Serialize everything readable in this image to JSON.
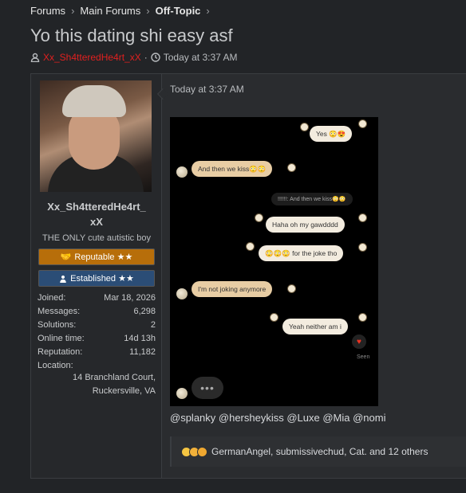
{
  "breadcrumb": [
    "Forums",
    "Main Forums",
    "Off-Topic"
  ],
  "thread": {
    "title": "Yo this dating shi easy asf",
    "author": "Xx_Sh4tteredHe4rt_xX",
    "separator": "·",
    "time": "Today at 3:37 AM"
  },
  "user": {
    "name_line1": "Xx_Sh4tteredHe4rt_",
    "name_line2": "xX",
    "title": "THE ONLY cute autistic boy",
    "badge_reputable": "Reputable ★★",
    "badge_established": "Established ★★",
    "stats": [
      {
        "label": "Joined:",
        "value": "Mar 18, 2026"
      },
      {
        "label": "Messages:",
        "value": "6,298"
      },
      {
        "label": "Solutions:",
        "value": "2"
      },
      {
        "label": "Online time:",
        "value": "14d 13h"
      },
      {
        "label": "Reputation:",
        "value": "11,182"
      },
      {
        "label": "Location:",
        "value": ""
      }
    ],
    "location_line1": "14 Branchland Court,",
    "location_line2": "Ruckersville, VA"
  },
  "post": {
    "time": "Today at 3:37 AM",
    "chat": [
      {
        "side": "r",
        "text": "Yes 😳😍"
      },
      {
        "side": "l",
        "text": "And then we kiss😳😳"
      },
      {
        "side": "sys",
        "text": "!!!!!!: And then we kiss😳😳"
      },
      {
        "side": "r",
        "text": "Haha oh my gawdddd"
      },
      {
        "side": "r",
        "text": "😳😳😳  for the joke tho"
      },
      {
        "side": "l",
        "text": "I'm not joking anymore"
      },
      {
        "side": "r",
        "text": "Yeah neither am i"
      }
    ],
    "seen": "Seen",
    "typing": "•••",
    "mentions": "@splanky @hersheykiss @Luxe @Mia @nomi",
    "reactions": "GermanAngel, submissivechud, Cat. and 12 others"
  },
  "colors": {
    "author": "#e0201f",
    "rep_badge": "#b76e0a",
    "est_badge": "#2b4d76"
  }
}
